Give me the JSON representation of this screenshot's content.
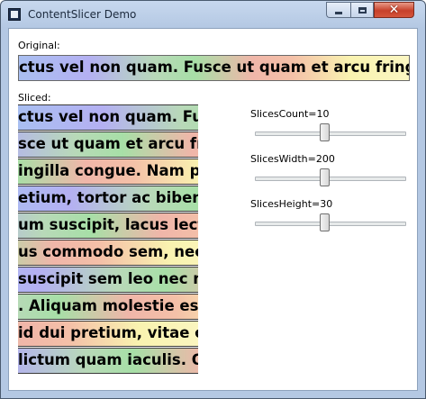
{
  "window": {
    "title": "ContentSlicer Demo",
    "minimize_glyph": "",
    "maximize_glyph": "",
    "close_glyph": "✕"
  },
  "original": {
    "label": "Original:",
    "text": "ctus vel non quam. Fusce ut quam et arcu fringill"
  },
  "sliced": {
    "label": "Sliced:",
    "slices": [
      "ctus vel non quam. Fus",
      "sce ut quam et arcu frin",
      "ingilla congue. Nam pre",
      "etium, tortor ac bibend",
      "um suscipit, lacus lectu",
      "us commodo sem, nec s",
      "suscipit sem leo nec mi",
      ". Aliquam molestie est",
      " id dui pretium, vitae c",
      "lictum quam iaculis. Q"
    ]
  },
  "sliders": [
    {
      "label": "SlicesCount=10",
      "level": 0.5
    },
    {
      "label": "SlicesWidth=200",
      "level": 0.5
    },
    {
      "label": "SlicesHeight=30",
      "level": 0.5
    }
  ],
  "colors": {
    "gradient": [
      "#a9bff1",
      "#b4b0f2",
      "#b8d9b8",
      "#f0b6a9",
      "#f9f3b0"
    ]
  }
}
